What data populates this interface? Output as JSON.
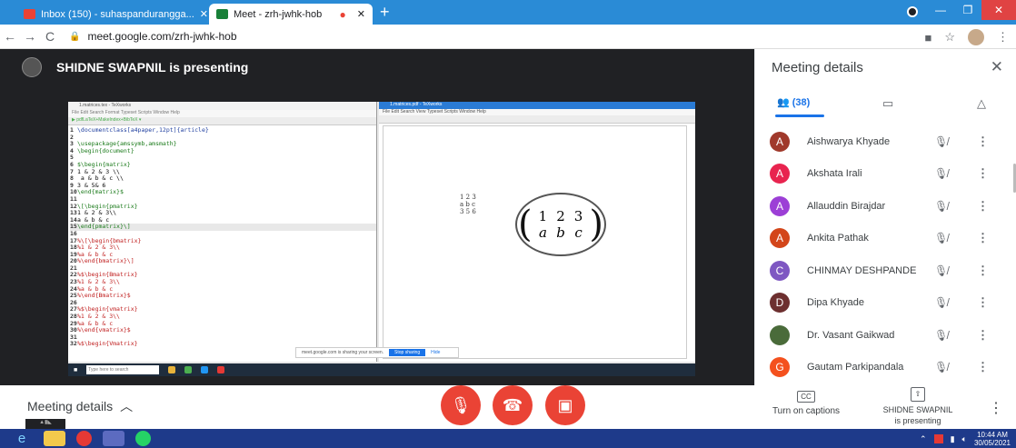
{
  "browser": {
    "tabs": [
      {
        "title": "Inbox (150) - suhaspandurangga...",
        "close": "✕",
        "fav_color": "#ea4335"
      },
      {
        "title": "Meet - zrh-jwhk-hob",
        "close": "✕",
        "fav_color": "#188038"
      }
    ],
    "new_tab": "+",
    "url": "meet.google.com/zrh-jwhk-hob"
  },
  "stage": {
    "presenter_label": "SHIDNE SWAPNIL is presenting",
    "editor": {
      "title": "1.matrices.tex - TeXworks",
      "menu": "File  Edit  Search  Format  Typeset  Scripts  Window  Help",
      "toolbar": "▶ pdfLaTeX+MakeIndex+BibTeX ▾",
      "lines": [
        {
          "n": "1",
          "text": "\\documentclass[a4paper,12pt]{article}",
          "cls": "blue"
        },
        {
          "n": "2",
          "text": "",
          "cls": ""
        },
        {
          "n": "3",
          "text": "\\usepackage{amssymb,amsmath}",
          "cls": "k"
        },
        {
          "n": "4",
          "text": "\\begin{document}",
          "cls": "k"
        },
        {
          "n": "5",
          "text": "",
          "cls": ""
        },
        {
          "n": "6",
          "text": "$\\begin{matrix}",
          "cls": "k"
        },
        {
          "n": "7",
          "text": "1 & 2 & 3 \\\\",
          "cls": ""
        },
        {
          "n": "8",
          "text": " a & b & c \\\\",
          "cls": ""
        },
        {
          "n": "9",
          "text": "3 & 5& 6",
          "cls": ""
        },
        {
          "n": "10",
          "text": "\\end{matrix}$",
          "cls": "k"
        },
        {
          "n": "11",
          "text": "",
          "cls": ""
        },
        {
          "n": "12",
          "text": "\\[\\begin{pmatrix}",
          "cls": "k"
        },
        {
          "n": "13",
          "text": "1 & 2 & 3\\\\",
          "cls": ""
        },
        {
          "n": "14",
          "text": "a & b & c",
          "cls": ""
        },
        {
          "n": "15",
          "text": "\\end{pmatrix}\\]",
          "cls": "k hl"
        },
        {
          "n": "16",
          "text": "",
          "cls": ""
        },
        {
          "n": "17",
          "text": "%\\[\\begin{bmatrix}",
          "cls": "r"
        },
        {
          "n": "18",
          "text": "%1 & 2 & 3\\\\",
          "cls": "r"
        },
        {
          "n": "19",
          "text": "%a & b & c",
          "cls": "r"
        },
        {
          "n": "20",
          "text": "%\\end{bmatrix}\\]",
          "cls": "r"
        },
        {
          "n": "21",
          "text": "",
          "cls": ""
        },
        {
          "n": "22",
          "text": "%$\\begin{Bmatrix}",
          "cls": "r"
        },
        {
          "n": "23",
          "text": "%1 & 2 & 3\\\\",
          "cls": "r"
        },
        {
          "n": "24",
          "text": "%a & b & c",
          "cls": "r"
        },
        {
          "n": "25",
          "text": "%\\end{Bmatrix}$",
          "cls": "r"
        },
        {
          "n": "26",
          "text": "",
          "cls": ""
        },
        {
          "n": "27",
          "text": "%$\\begin{vmatrix}",
          "cls": "r"
        },
        {
          "n": "28",
          "text": "%1 & 2 & 3\\\\",
          "cls": "r"
        },
        {
          "n": "29",
          "text": "%a & b & c",
          "cls": "r"
        },
        {
          "n": "30",
          "text": "%\\end{vmatrix}$",
          "cls": "r"
        },
        {
          "n": "31",
          "text": "",
          "cls": ""
        },
        {
          "n": "32",
          "text": "%$\\begin{Vmatrix}",
          "cls": "r"
        }
      ]
    },
    "viewer": {
      "title": "1.matrices.pdf - TeXworks",
      "menu": "File  Edit  Search  View  Typeset  Scripts  Window  Help",
      "small_matrix": [
        "1  2  3",
        "a  b  c",
        "3  5  6"
      ],
      "big_matrix": {
        "row1": [
          "1",
          "2",
          "3"
        ],
        "row2": [
          "a",
          "b",
          "c"
        ]
      }
    },
    "share_banner": {
      "text": "meet.google.com is sharing your screen.",
      "stop": "Stop sharing",
      "hide": "Hide"
    },
    "win_search": "Type here to search"
  },
  "toolbar": {
    "meeting_details": "Meeting details",
    "captions": "Turn on captions",
    "cc_icon": "CC",
    "presenting": "SHIDNE SWAPNIL\nis presenting",
    "more": "⋮"
  },
  "panel": {
    "title": "Meeting details",
    "people_count": "(38)",
    "participants": [
      {
        "initial": "A",
        "name": "Aishwarya Khyade",
        "color": "#a0392b"
      },
      {
        "initial": "A",
        "name": "Akshata Irali",
        "color": "#e8244f"
      },
      {
        "initial": "A",
        "name": "Allauddin Birajdar",
        "color": "#9c3fd6"
      },
      {
        "initial": "A",
        "name": "Ankita Pathak",
        "color": "#d3461a"
      },
      {
        "initial": "C",
        "name": "CHINMAY DESHPANDE",
        "color": "#7e57c2"
      },
      {
        "initial": "D",
        "name": "Dipa Khyade",
        "color": "#6d2f2f"
      },
      {
        "initial": "",
        "name": "Dr. Vasant Gaikwad",
        "color": "#4a6b3a"
      },
      {
        "initial": "G",
        "name": "Gautam Parkipandala",
        "color": "#f4511e"
      }
    ]
  },
  "taskbar": {
    "time": "10:44 AM",
    "date": "30/05/2021"
  }
}
